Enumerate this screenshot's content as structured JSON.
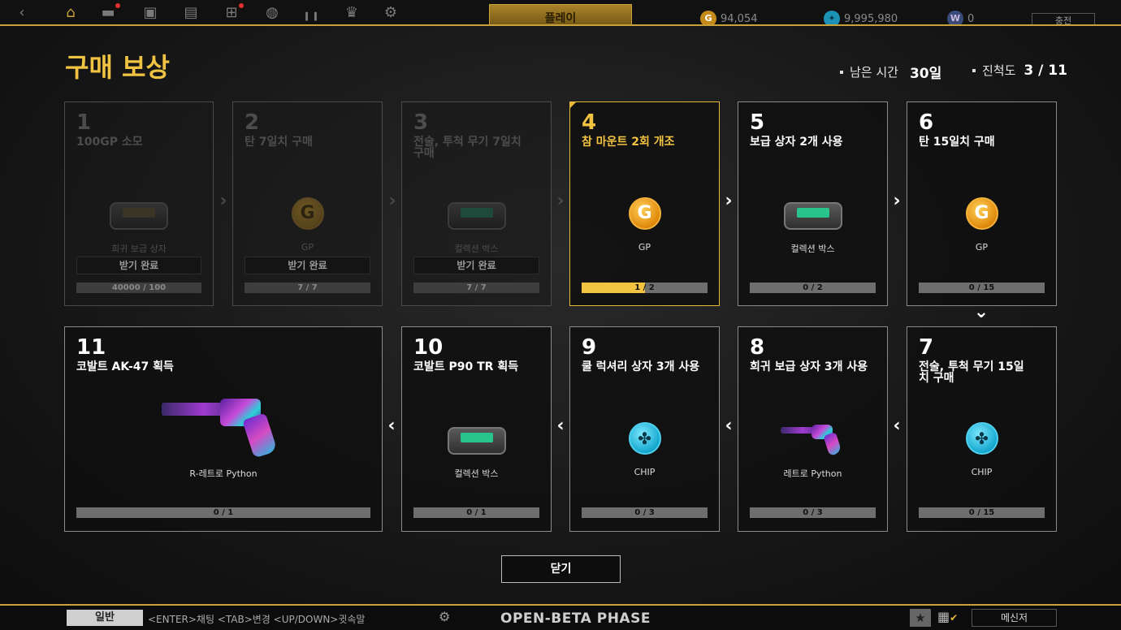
{
  "topbar": {
    "play_label": "플레이",
    "gp_amount": "94,054",
    "chip_amount": "9,995,980",
    "w_amount": "0",
    "charge_label": "충전"
  },
  "modal": {
    "title": "구매 보상",
    "remaining_label": "남은 시간",
    "remaining_value": "30일",
    "progress_label": "진척도",
    "progress_value": "3 / 11",
    "close_label": "닫기"
  },
  "cards": [
    {
      "num": "1",
      "title": "100GP 소모",
      "icon": "supply-box-icon",
      "reward": "희귀 보급 상자",
      "claim": "받기 완료",
      "progress": "40000 / 100",
      "fraction": 1.0,
      "state": "done"
    },
    {
      "num": "2",
      "title": "탄 7일치 구매",
      "icon": "gp-coin-icon",
      "reward": "GP",
      "claim": "받기 완료",
      "progress": "7 / 7",
      "fraction": 1.0,
      "state": "done"
    },
    {
      "num": "3",
      "title": "전술, 투척 무기 7일치 구매",
      "icon": "collection-box-icon",
      "reward": "컬렉션 박스",
      "claim": "받기 완료",
      "progress": "7 / 7",
      "fraction": 1.0,
      "state": "done"
    },
    {
      "num": "4",
      "title": "참 마운트 2회 개조",
      "icon": "gp-coin-icon",
      "reward": "GP",
      "progress": "1 / 2",
      "fraction": 0.5,
      "state": "active"
    },
    {
      "num": "5",
      "title": "보급 상자 2개 사용",
      "icon": "collection-box-icon",
      "reward": "컬렉션 박스",
      "progress": "0 / 2",
      "fraction": 0,
      "state": "locked"
    },
    {
      "num": "6",
      "title": "탄 15일치 구매",
      "icon": "gp-coin-icon",
      "reward": "GP",
      "progress": "0 / 15",
      "fraction": 0,
      "state": "locked"
    },
    {
      "num": "7",
      "title": "전술, 투척 무기 15일치 구매",
      "icon": "chip-icon",
      "reward": "CHIP",
      "progress": "0 / 15",
      "fraction": 0,
      "state": "locked"
    },
    {
      "num": "8",
      "title": "희귀 보급 상자 3개 사용",
      "icon": "revolver-icon",
      "reward": "레트로 Python",
      "progress": "0 / 3",
      "fraction": 0,
      "state": "locked"
    },
    {
      "num": "9",
      "title": "쿨 럭셔리 상자 3개 사용",
      "icon": "chip-icon",
      "reward": "CHIP",
      "progress": "0 / 3",
      "fraction": 0,
      "state": "locked"
    },
    {
      "num": "10",
      "title": "코발트 P90 TR 획득",
      "icon": "collection-box-icon",
      "reward": "컬렉션 박스",
      "progress": "0 / 1",
      "fraction": 0,
      "state": "locked"
    },
    {
      "num": "11",
      "title": "코발트 AK-47 획득",
      "icon": "revolver-icon",
      "reward": "R-레트로 Python",
      "progress": "0 / 1",
      "fraction": 0,
      "state": "locked"
    }
  ],
  "bottombar": {
    "chat_tab": "일반",
    "chat_hint": "<ENTER>채팅 <TAB>변경 <UP/DOWN>귓속말",
    "phase": "OPEN-BETA PHASE",
    "messenger": "메신저"
  },
  "colors": {
    "accent": "#f2c341",
    "chip": "#16a8cf"
  }
}
